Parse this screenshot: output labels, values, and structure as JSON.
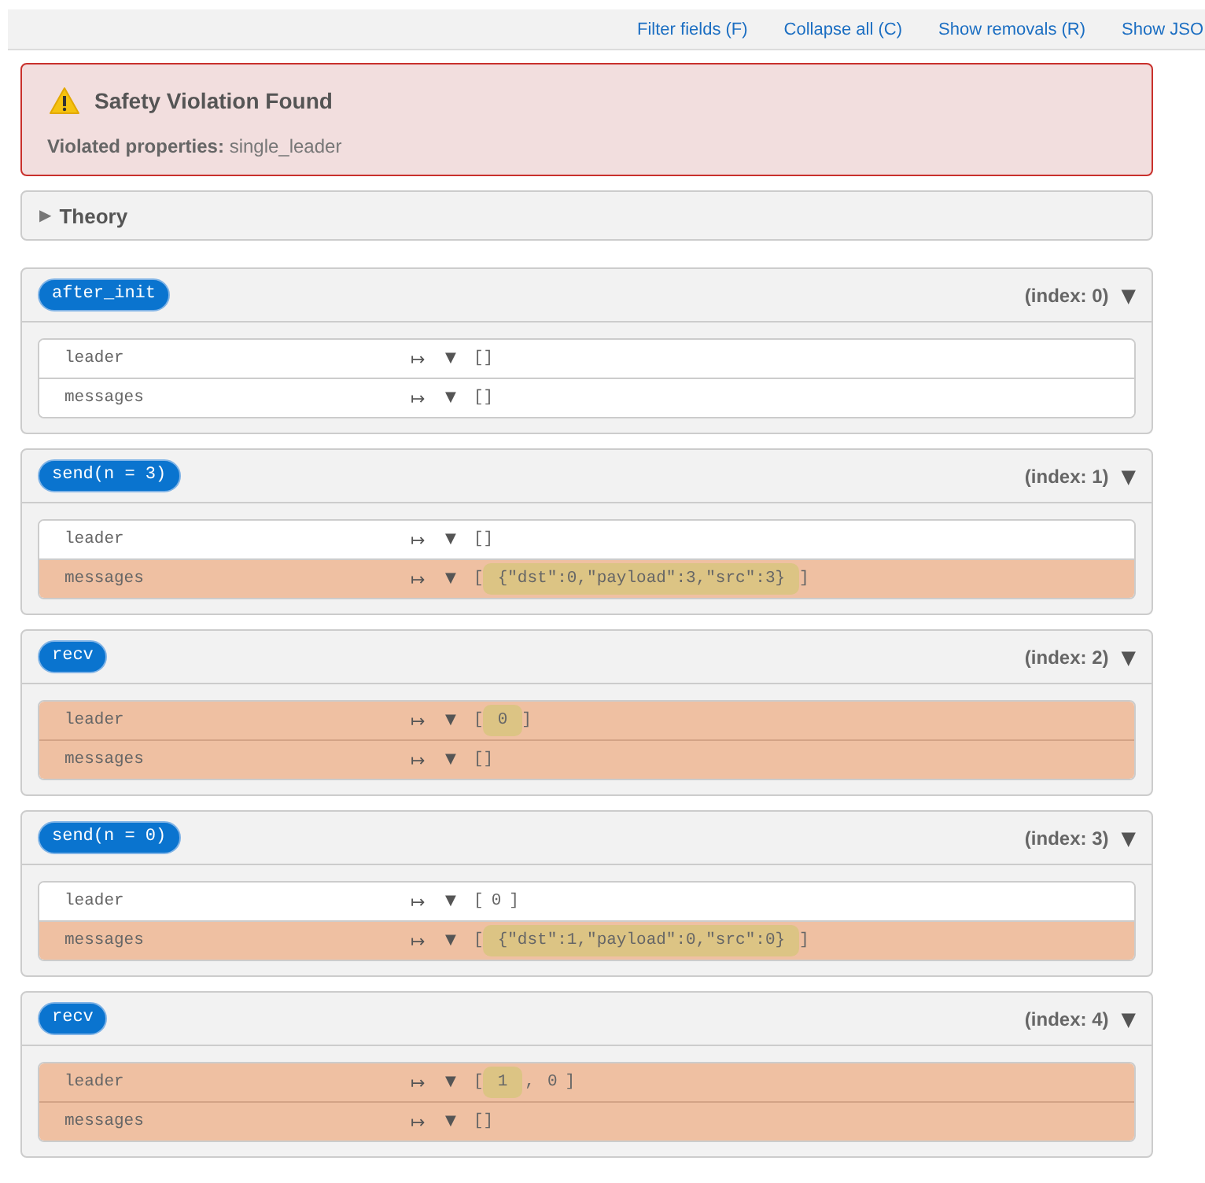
{
  "toolbar": {
    "links": [
      "Filter fields (F)",
      "Collapse all (C)",
      "Show removals (R)",
      "Show JSO"
    ]
  },
  "alert": {
    "title": "Safety Violation Found",
    "text": "**Violated properties:** single_leader"
  },
  "theory": {
    "toggle": "▶",
    "label": "Theory"
  },
  "states": [
    {
      "action": "after_init",
      "index_label": "(index: 0)",
      "toggle": "▼",
      "rows": [
        {
          "field": "leader",
          "changed": false,
          "maps_to": "↦",
          "toggle": "▼",
          "value": {
            "kind": "text",
            "text": "[]"
          }
        },
        {
          "field": "messages",
          "changed": false,
          "maps_to": "↦",
          "toggle": "▼",
          "value": {
            "kind": "text",
            "text": "[]"
          }
        }
      ]
    },
    {
      "action": "send(n = 3)",
      "index_label": "(index: 1)",
      "toggle": "▼",
      "rows": [
        {
          "field": "leader",
          "changed": false,
          "maps_to": "↦",
          "toggle": "▼",
          "value": {
            "kind": "text",
            "text": "[]"
          }
        },
        {
          "field": "messages",
          "changed": true,
          "maps_to": "↦",
          "toggle": "▼",
          "value": {
            "kind": "list",
            "open": "[",
            "items": [
              {
                "text": "{\"dst\":0,\"payload\":3,\"src\":3}",
                "changed": true
              }
            ],
            "close": "]"
          }
        }
      ]
    },
    {
      "action": "recv",
      "index_label": "(index: 2)",
      "toggle": "▼",
      "rows": [
        {
          "field": "leader",
          "changed": true,
          "maps_to": "↦",
          "toggle": "▼",
          "value": {
            "kind": "list",
            "open": "[",
            "items": [
              {
                "text": "0",
                "changed": true
              }
            ],
            "close": "]"
          }
        },
        {
          "field": "messages",
          "changed": true,
          "maps_to": "↦",
          "toggle": "▼",
          "value": {
            "kind": "text",
            "text": "[]"
          }
        }
      ]
    },
    {
      "action": "send(n = 0)",
      "index_label": "(index: 3)",
      "toggle": "▼",
      "rows": [
        {
          "field": "leader",
          "changed": false,
          "maps_to": "↦",
          "toggle": "▼",
          "value": {
            "kind": "list",
            "open": "[",
            "items": [
              {
                "text": "0",
                "changed": false
              }
            ],
            "close": "]"
          }
        },
        {
          "field": "messages",
          "changed": true,
          "maps_to": "↦",
          "toggle": "▼",
          "value": {
            "kind": "list",
            "open": "[",
            "items": [
              {
                "text": "{\"dst\":1,\"payload\":0,\"src\":0}",
                "changed": true
              }
            ],
            "close": "]"
          }
        }
      ]
    },
    {
      "action": "recv",
      "index_label": "(index: 4)",
      "toggle": "▼",
      "rows": [
        {
          "field": "leader",
          "changed": true,
          "maps_to": "↦",
          "toggle": "▼",
          "value": {
            "kind": "list",
            "open": "[",
            "items": [
              {
                "text": "1",
                "changed": true
              },
              {
                "text": "0",
                "changed": false
              }
            ],
            "separator": ",",
            "close": "]"
          }
        },
        {
          "field": "messages",
          "changed": true,
          "maps_to": "↦",
          "toggle": "▼",
          "value": {
            "kind": "text",
            "text": "[]"
          }
        }
      ]
    }
  ]
}
